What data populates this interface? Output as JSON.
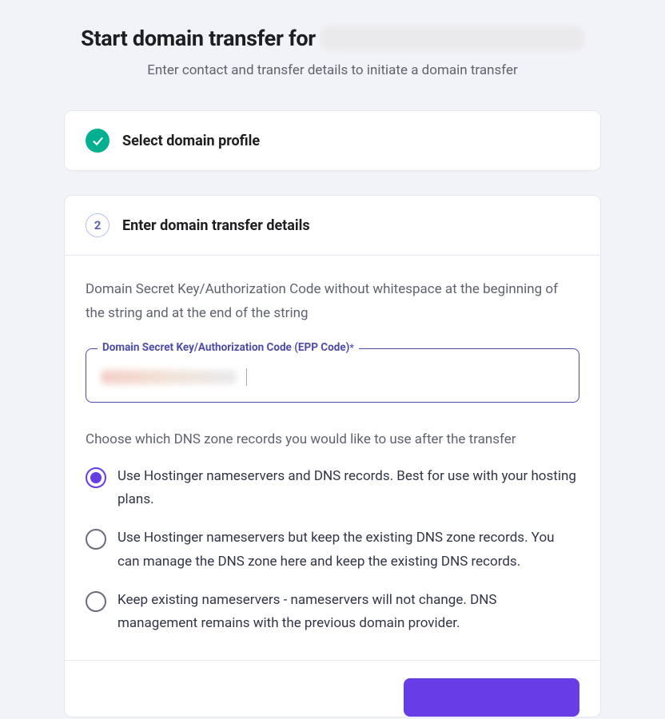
{
  "header": {
    "title_prefix": "Start domain transfer for",
    "subtitle": "Enter contact and transfer details to initiate a domain transfer"
  },
  "step1": {
    "title": "Select domain profile"
  },
  "step2": {
    "number": "2",
    "title": "Enter domain transfer details",
    "desc": "Domain Secret Key/Authorization Code without whitespace at the beginning of the string and at the end of the string",
    "input_label": "Domain Secret Key/Authorization Code (EPP Code)",
    "required_marker": "*",
    "dns_desc": "Choose which DNS zone records you would like to use after the transfer",
    "options": [
      "Use Hostinger nameservers and DNS records. Best for use with your hosting plans.",
      "Use Hostinger nameservers but keep the existing DNS zone records. You can manage the DNS zone here and keep the existing DNS records.",
      "Keep existing nameservers - nameservers will not change. DNS management remains with the previous domain provider."
    ],
    "selected_index": 0
  }
}
